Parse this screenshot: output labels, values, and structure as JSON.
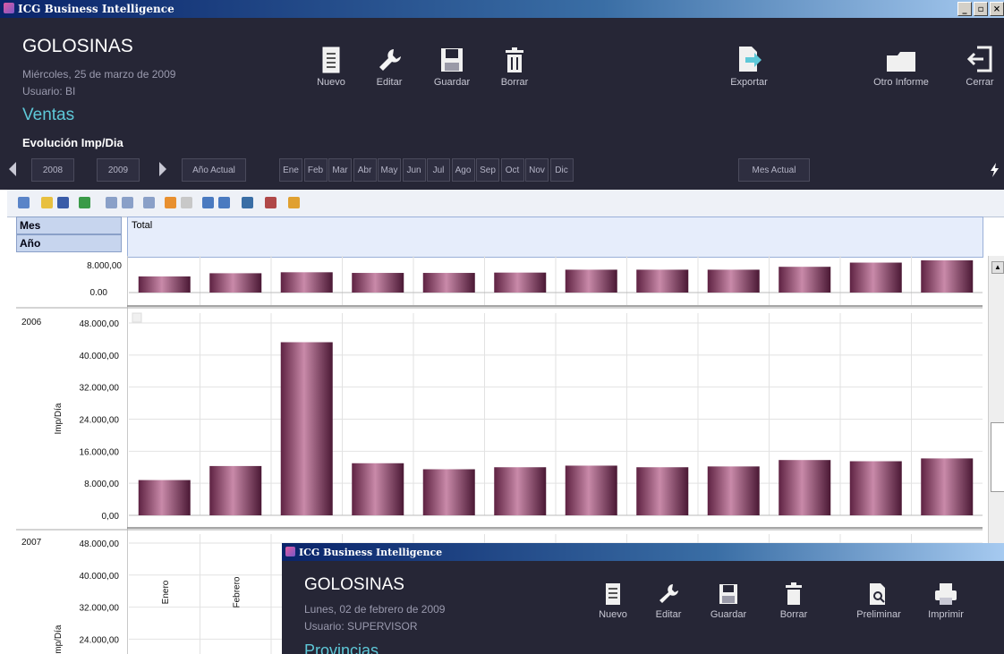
{
  "window": {
    "title": "ICG Business Intelligence",
    "controls": [
      "_",
      "▫",
      "×"
    ]
  },
  "header": {
    "app_title": "GOLOSINAS",
    "date": "Miércoles, 25 de marzo de 2009",
    "user": "Usuario:  BI",
    "section": "Ventas",
    "report": "Evolución Imp/Dia"
  },
  "toolbar": {
    "nuevo": "Nuevo",
    "editar": "Editar",
    "guardar": "Guardar",
    "borrar": "Borrar",
    "exportar": "Exportar",
    "otro_informe": "Otro Informe",
    "cerrar": "Cerrar"
  },
  "nav": {
    "years": [
      "2008",
      "2009"
    ],
    "anio_actual": "Año Actual",
    "months": [
      "Ene",
      "Feb",
      "Mar",
      "Abr",
      "May",
      "Jun",
      "Jul",
      "Ago",
      "Sep",
      "Oct",
      "Nov",
      "Dic"
    ],
    "mes_actual": "Mes Actual"
  },
  "pivot": {
    "row_fields": [
      "Mes",
      "Año"
    ],
    "column_header": "Total"
  },
  "colors": {
    "header_bg": "#262636",
    "accent": "#5ec8d8",
    "bar": "#8a3a62"
  },
  "chart_data": [
    {
      "type": "bar",
      "row_label": "",
      "yticks": [
        "0.00"
      ],
      "clipped_tick": "8.000,00",
      "values_relative": [
        0.5,
        0.6,
        0.63,
        0.61,
        0.61,
        0.62,
        0.71,
        0.71,
        0.71,
        0.8,
        0.93,
        1.0
      ]
    },
    {
      "type": "bar",
      "row_label": "2006",
      "ylabel": "Imp/Día",
      "ylim": [
        0,
        48000
      ],
      "yticks": [
        "48.000,00",
        "40.000,00",
        "32.000,00",
        "24.000,00",
        "16.000,00",
        "8.000,00",
        "0,00"
      ],
      "values": [
        8800,
        12300,
        43200,
        13000,
        11500,
        12000,
        12400,
        12000,
        12200,
        13800,
        13500,
        14200
      ]
    },
    {
      "type": "bar",
      "row_label": "2007",
      "ylabel": "Imp/Día",
      "yticks": [
        "48.000,00",
        "40.000,00",
        "32.000,00",
        "24.000,00"
      ],
      "categories": [
        "Enero",
        "Febrero"
      ]
    }
  ],
  "overlay": {
    "title": "ICG Business Intelligence",
    "app_title": "GOLOSINAS",
    "date": "Lunes, 02 de febrero de 2009",
    "user": "Usuario:  SUPERVISOR",
    "section": "Provincias",
    "toolbar": {
      "nuevo": "Nuevo",
      "editar": "Editar",
      "guardar": "Guardar",
      "borrar": "Borrar",
      "preliminar": "Preliminar",
      "imprimir": "Imprimir"
    }
  }
}
